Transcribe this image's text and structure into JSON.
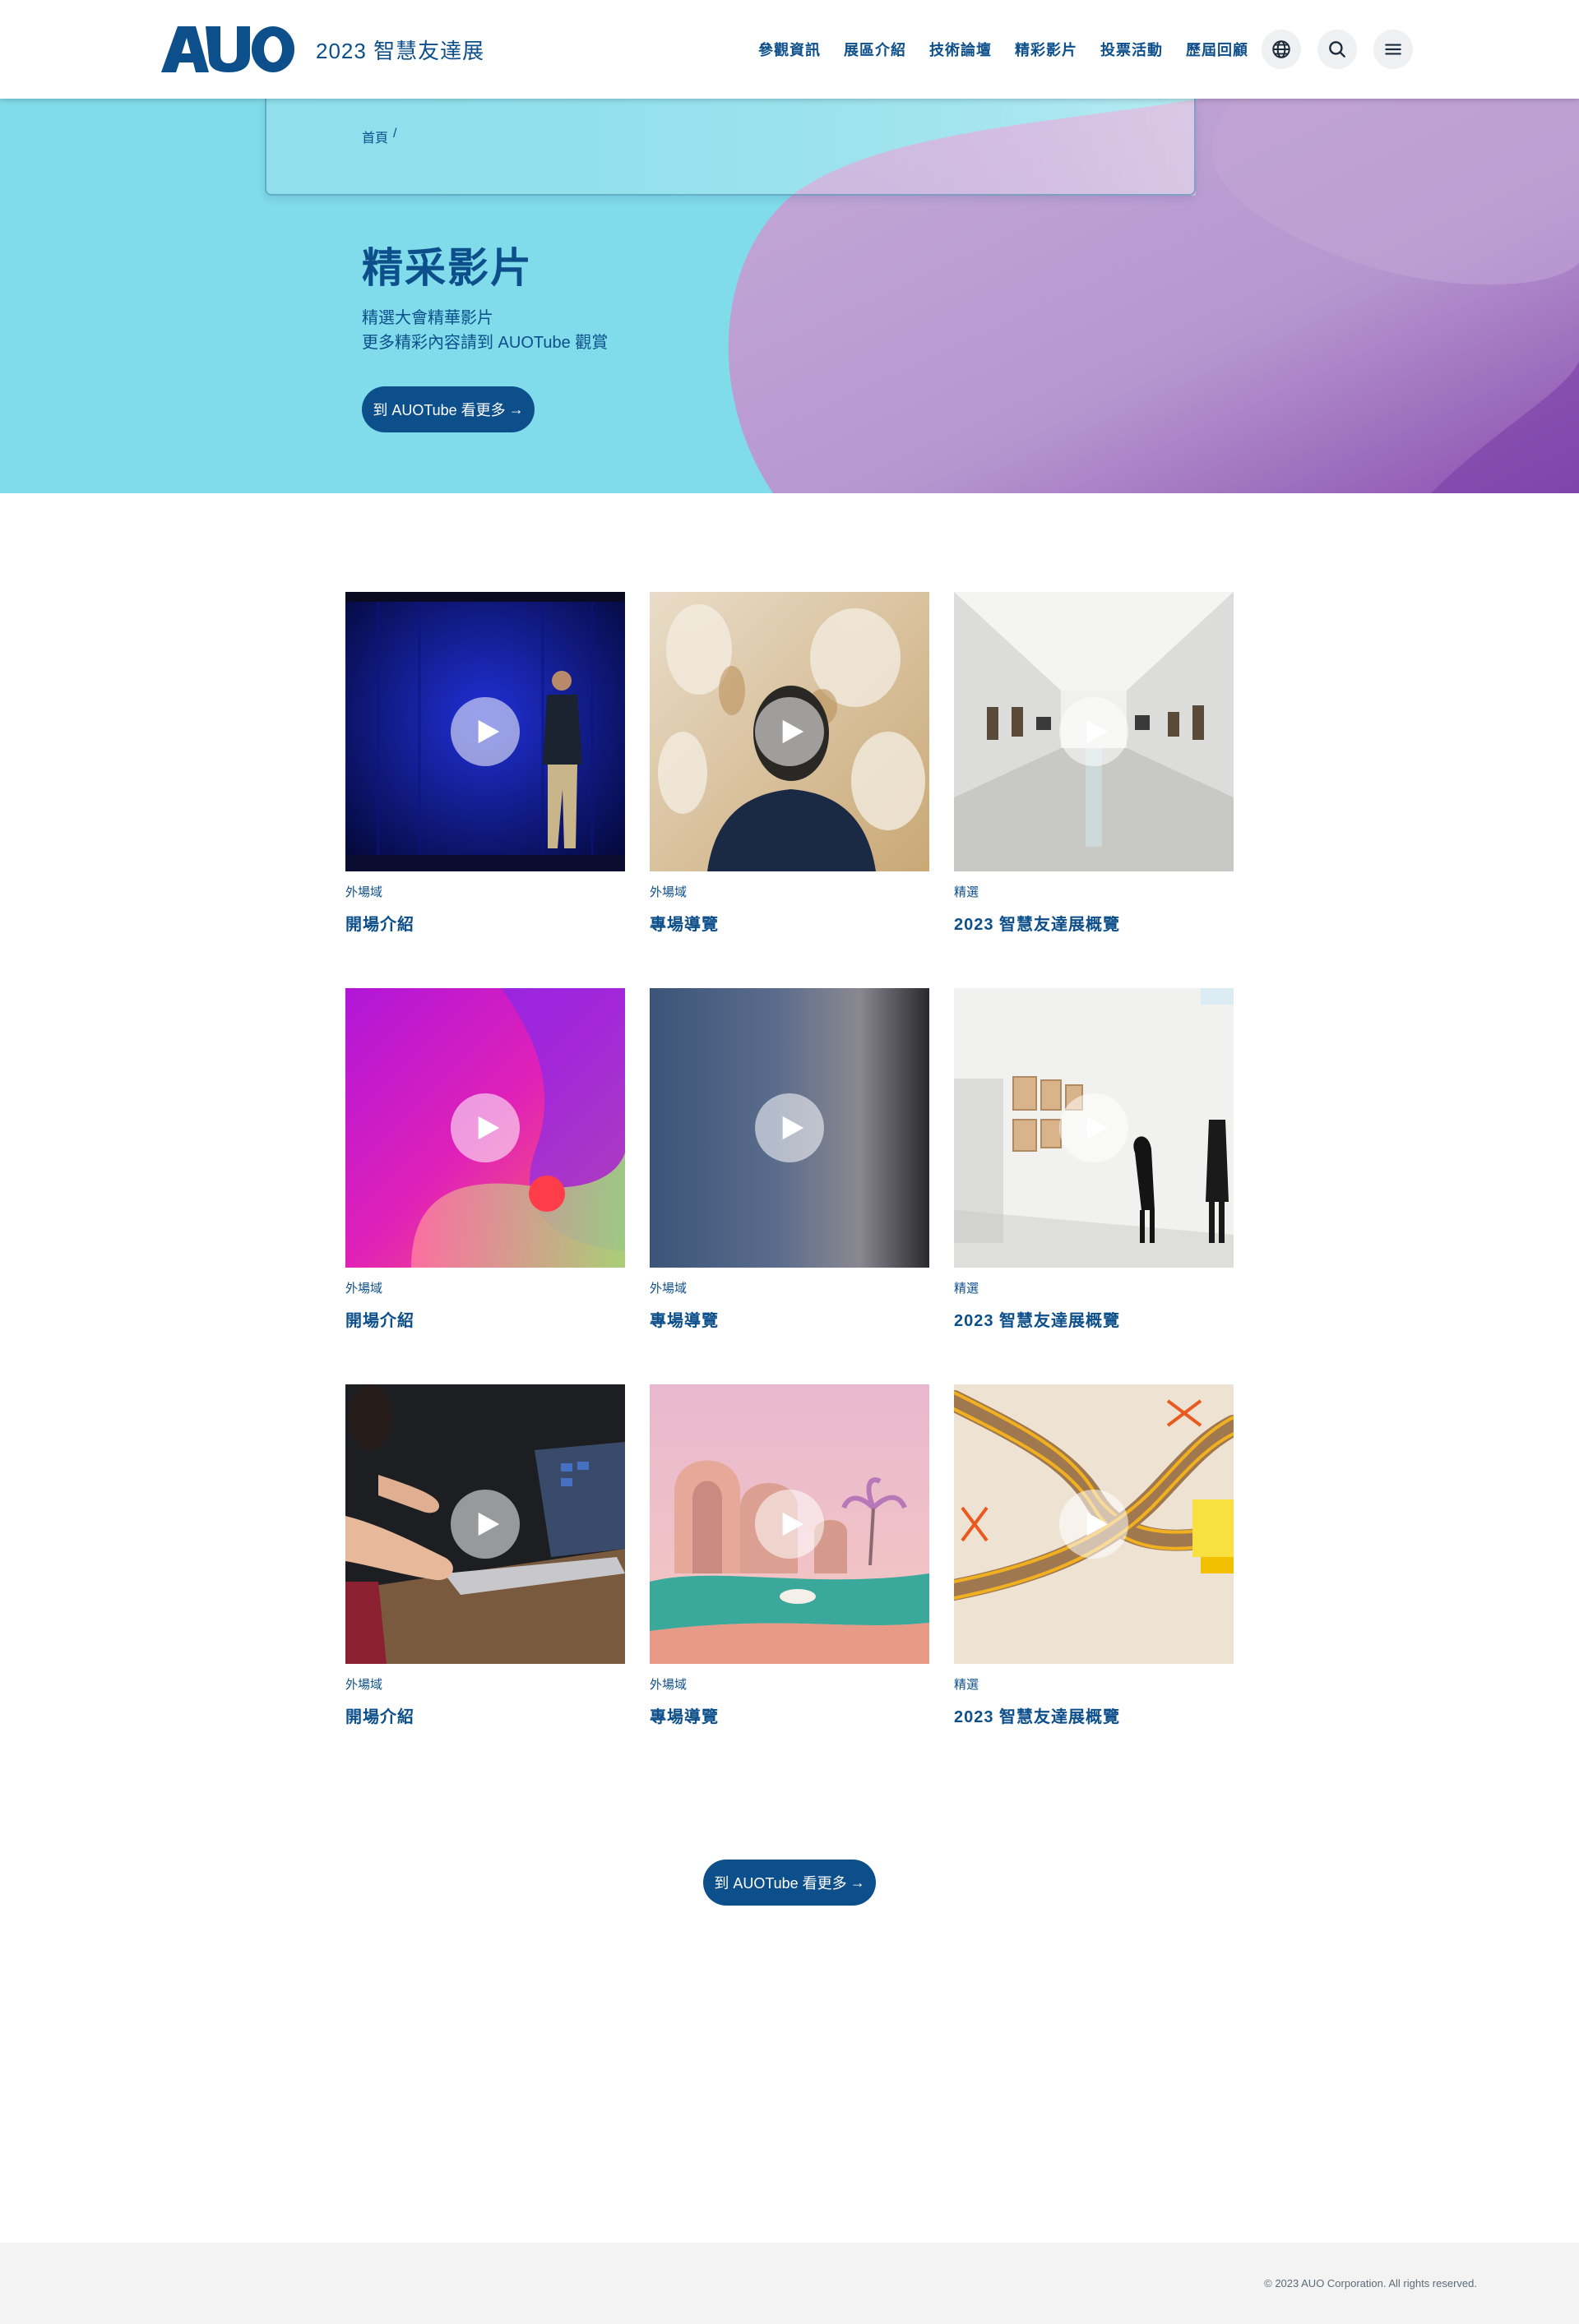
{
  "header": {
    "site_title": "2023 智慧友達展",
    "nav": [
      "參觀資訊",
      "展區介紹",
      "技術論壇",
      "精彩影片",
      "投票活動",
      "歷屆回顧"
    ],
    "icons": [
      "globe-icon",
      "search-icon",
      "menu-icon"
    ]
  },
  "hero": {
    "breadcrumb": [
      "首頁",
      "/"
    ],
    "title": "精采影片",
    "desc_line1": "精選大會精華影片",
    "desc_line2": "更多精彩內容請到 AUOTube 觀賞",
    "button_label": "到 AUOTube 看更多",
    "button_arrow": "→"
  },
  "videos": [
    {
      "tag": "外場域",
      "title": "開場介紹"
    },
    {
      "tag": "外場域",
      "title": "專場導覽"
    },
    {
      "tag": "精選",
      "title": "2023 智慧友達展概覽"
    },
    {
      "tag": "外場域",
      "title": "開場介紹"
    },
    {
      "tag": "外場域",
      "title": "專場導覽"
    },
    {
      "tag": "精選",
      "title": "2023 智慧友達展概覽"
    },
    {
      "tag": "外場域",
      "title": "開場介紹"
    },
    {
      "tag": "外場域",
      "title": "專場導覽"
    },
    {
      "tag": "精選",
      "title": "2023 智慧友達展概覽"
    }
  ],
  "more_button": {
    "label": "到 AUOTube 看更多",
    "arrow": "→"
  },
  "footer": {
    "copyright": "© 2023 AUO Corporation. All rights reserved."
  },
  "colors": {
    "primary": "#0d4f8b",
    "hero_cyan": "#80dbea",
    "hero_purple": "#b79fd2",
    "footer_bg": "#f3f3f3"
  }
}
